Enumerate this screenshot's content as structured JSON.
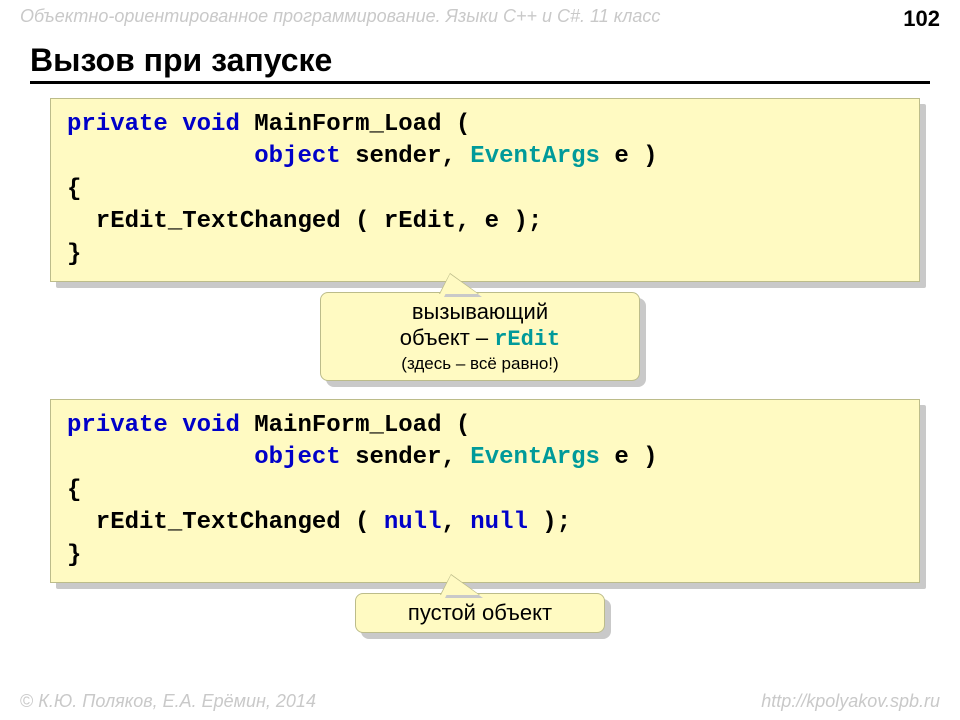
{
  "header": {
    "course": "Объектно-ориентированное программирование. Языки C++ и C#. 11 класс",
    "page": "102"
  },
  "title": "Вызов при запуске",
  "code1": {
    "l1a": "private",
    "l1b": " ",
    "l1c": "void",
    "l1d": " MainForm_Load (",
    "l2a": "             ",
    "l2b": "object",
    "l2c": " ",
    "l2d": "sender",
    "l2e": ", ",
    "l2f": "EventArgs",
    "l2g": " e )",
    "l3": "{",
    "l4": "  rEdit_TextChanged ( rEdit, e );",
    "l5": "}"
  },
  "callout1": {
    "line1": "вызывающий",
    "line2a": "объект – ",
    "line2b": "rEdit",
    "line3": "(здесь – всё равно!)"
  },
  "code2": {
    "l1a": "private",
    "l1b": " ",
    "l1c": "void",
    "l1d": " MainForm_Load (",
    "l2a": "             ",
    "l2b": "object",
    "l2c": " ",
    "l2d": "sender",
    "l2e": ", ",
    "l2f": "EventArgs",
    "l2g": " e )",
    "l3": "{",
    "l4a": "  rEdit_TextChanged ( ",
    "l4b": "null",
    "l4c": ", ",
    "l4d": "null",
    "l4e": " );",
    "l5": "}"
  },
  "callout2": {
    "text": "пустой объект"
  },
  "footer": {
    "authors": " К.Ю. Поляков, Е.А. Ерёмин, 2014",
    "url": "http://kpolyakov.spb.ru"
  }
}
